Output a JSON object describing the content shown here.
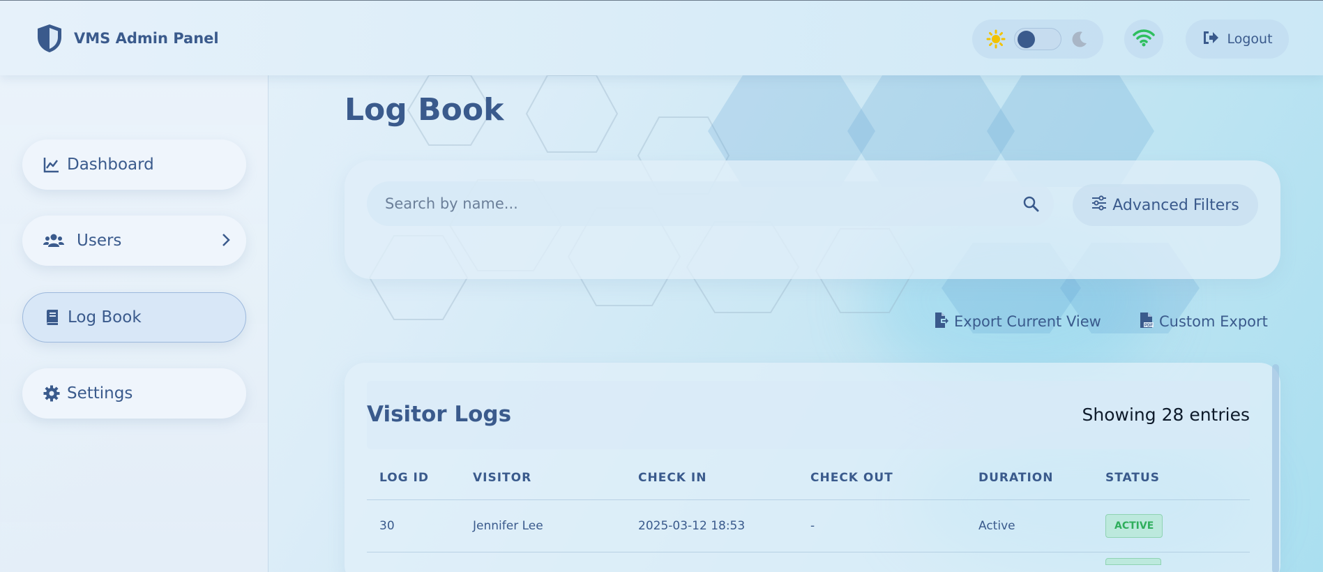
{
  "app": {
    "title": "VMS Admin Panel"
  },
  "header": {
    "logout_label": "Logout"
  },
  "sidebar": {
    "items": [
      {
        "label": "Dashboard"
      },
      {
        "label": "Users"
      },
      {
        "label": "Log Book"
      },
      {
        "label": "Settings"
      }
    ]
  },
  "main": {
    "page_title": "Log Book",
    "search": {
      "placeholder": "Search by name..."
    },
    "advanced_filters_label": "Advanced Filters",
    "export_current_label": "Export Current View",
    "custom_export_label": "Custom Export"
  },
  "logs": {
    "title": "Visitor Logs",
    "count_text": "Showing 28 entries",
    "columns": [
      "LOG ID",
      "VISITOR",
      "CHECK IN",
      "CHECK OUT",
      "DURATION",
      "STATUS"
    ],
    "rows": [
      {
        "log_id": "30",
        "visitor": "Jennifer Lee",
        "check_in": "2025-03-12 18:53",
        "check_out": "-",
        "duration": "Active",
        "status": "ACTIVE"
      }
    ]
  },
  "colors": {
    "primary": "#3a5a8c",
    "sun": "#f2c200",
    "wifi": "#2fbf5f",
    "status_active": "#2fae5c"
  }
}
